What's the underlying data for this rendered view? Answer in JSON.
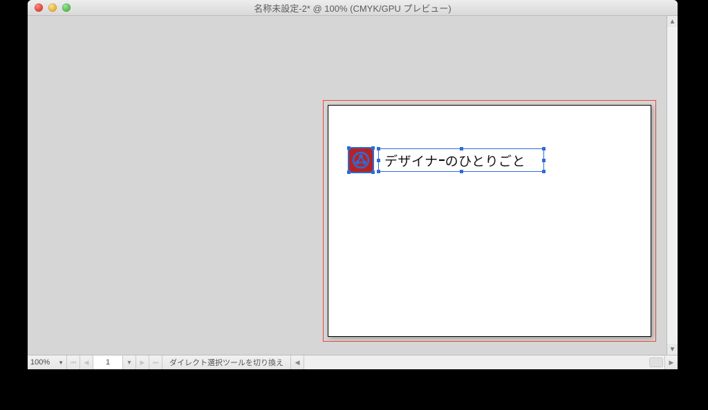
{
  "window": {
    "title": "名称未設定-2* @ 100% (CMYK/GPU プレビュー)"
  },
  "canvas": {
    "text_object_pre": "デザイナ",
    "text_object_post": "のひとりごと"
  },
  "statusbar": {
    "zoom": "100%",
    "page": "1",
    "hint": "ダイレクト選択ツールを切り換え"
  },
  "icons": {
    "close": "close",
    "minimize": "minimize",
    "maximize": "maximize",
    "up": "▲",
    "down": "▼",
    "first": "⏮",
    "prev": "◀",
    "next": "▶",
    "last": "⏭",
    "dd": "▼"
  }
}
